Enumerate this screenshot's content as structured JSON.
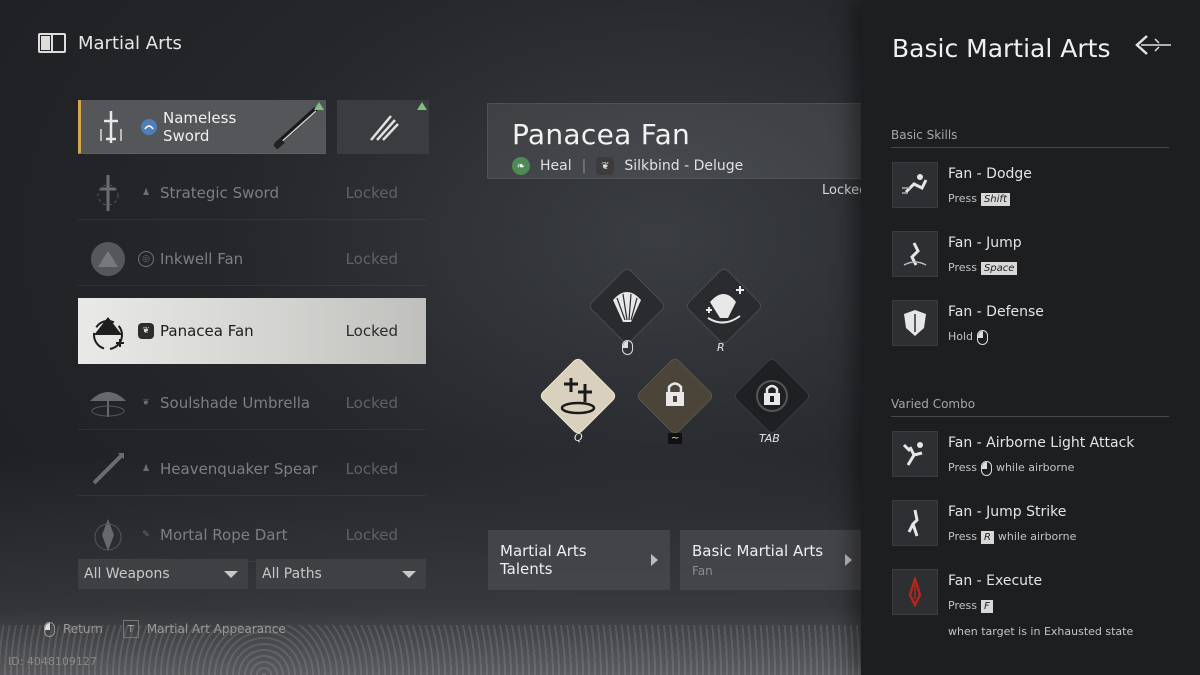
{
  "header": {
    "title": "Martial Arts",
    "icon": "book-icon"
  },
  "weapons": [
    {
      "name": "Nameless Sword",
      "status": "",
      "state": "equipped"
    },
    {
      "name": "Strategic Sword",
      "status": "Locked",
      "state": "locked"
    },
    {
      "name": "Inkwell Fan",
      "status": "Locked",
      "state": "locked"
    },
    {
      "name": "Panacea Fan",
      "status": "Locked",
      "state": "selected"
    },
    {
      "name": "Soulshade Umbrella",
      "status": "Locked",
      "state": "locked"
    },
    {
      "name": "Heavenquaker Spear",
      "status": "Locked",
      "state": "locked"
    },
    {
      "name": "Mortal Rope Dart",
      "status": "Locked",
      "state": "locked"
    }
  ],
  "filters": {
    "weapons": "All Weapons",
    "paths": "All Paths"
  },
  "footer": {
    "return_label": "Return",
    "appearance_key": "T",
    "appearance_label": "Martial Art Appearance",
    "uid": "ID: 4048109127"
  },
  "detail": {
    "title": "Panacea Fan",
    "tag1": "Heal",
    "tag2": "Silkbind - Deluge",
    "locked": "Locked"
  },
  "skill_keys": {
    "r": "R",
    "q": "Q",
    "tilde": "~",
    "tab": "TAB"
  },
  "buttons": {
    "talents": "Martial Arts Talents",
    "basic": "Basic Martial Arts",
    "basic_sub": "Fan"
  },
  "panel": {
    "title": "Basic Martial Arts",
    "section_basic": "Basic Skills",
    "section_combo": "Varied Combo",
    "skills": [
      {
        "name": "Fan - Dodge",
        "prefix": "Press",
        "key": "Shift",
        "suffix": ""
      },
      {
        "name": "Fan - Jump",
        "prefix": "Press",
        "key": "Space",
        "suffix": ""
      },
      {
        "name": "Fan - Defense",
        "prefix": "Hold",
        "key": "",
        "suffix": ""
      },
      {
        "name": "Fan - Airborne Light Attack",
        "prefix": "Press",
        "key": "",
        "suffix": "while airborne"
      },
      {
        "name": "Fan - Jump Strike",
        "prefix": "Press",
        "key": "R",
        "suffix": "while airborne"
      },
      {
        "name": "Fan - Execute",
        "prefix": "Press",
        "key": "F",
        "suffix": "when target is in Exhausted state"
      }
    ]
  },
  "colors": {
    "accent_gold": "#d4a84a",
    "new_marker": "#79c27a",
    "execute_red": "#b3261e"
  }
}
